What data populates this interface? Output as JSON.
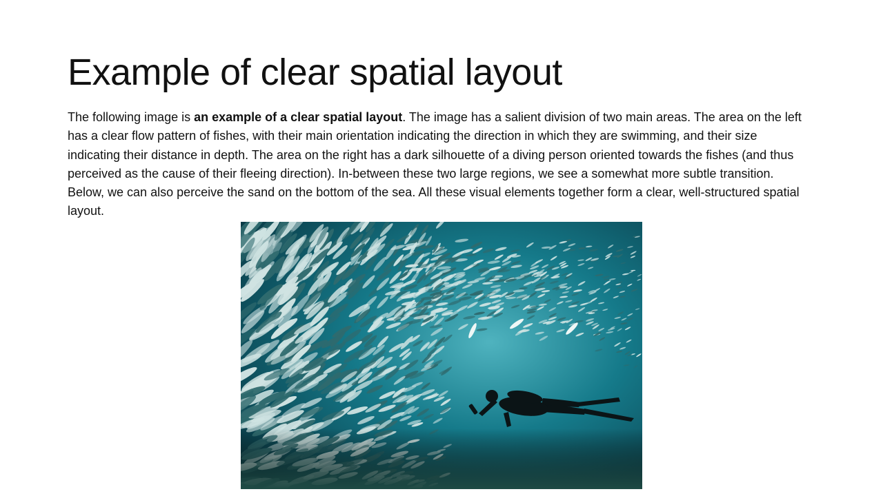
{
  "slide": {
    "title": "Example of clear spatial layout",
    "paragraph": {
      "before_bold": "The following image is ",
      "bold": "an example of a clear spatial layout",
      "after_bold": ". The image has a salient division of two main areas. The area on the left has a clear flow pattern of fishes, with their main orientation indicating the direction in which they are swimming, and their size indicating their distance in depth. The area on the right has a dark silhouette of a diving person oriented towards the fishes (and thus perceived as the cause of their fleeing direction). In-between these two large regions, we see a somewhat more subtle transition. Below, we can also perceive the sand on the bottom of the sea. All these visual elements together form a clear, well-structured spatial layout."
    },
    "image": {
      "subject": "school-of-fish-and-diver-photo",
      "colors": {
        "deep_water": "#0a3c48",
        "mid_water": "#157a8a",
        "light_water": "#4fb3bf",
        "fish_silver": "#cfe3e2",
        "fish_dark": "#2f6a6e",
        "diver": "#0b1416",
        "sand": "#1e4a44"
      }
    }
  }
}
